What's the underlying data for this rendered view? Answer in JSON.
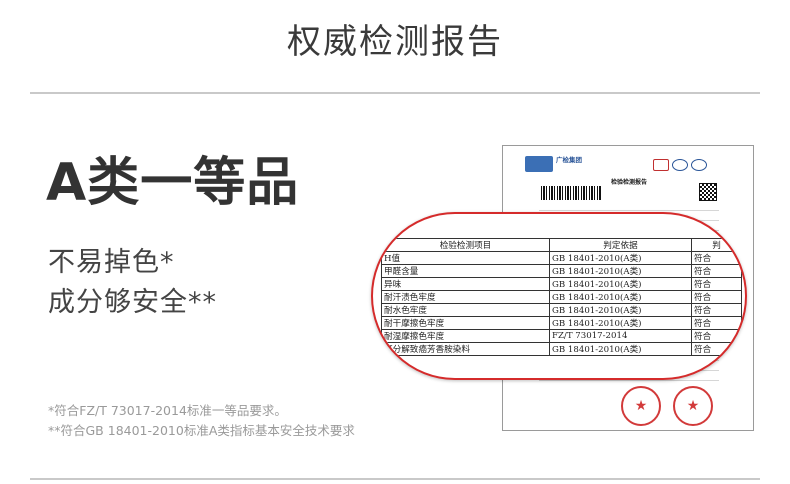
{
  "page": {
    "title": "权威检测报告",
    "headline": "A类一等品",
    "subtitle_1": "不易掉色*",
    "subtitle_2": "成分够安全**",
    "note_1": "*符合FZ/T 73017-2014标准一等品要求。",
    "note_2": "**符合GB 18401-2010标准A类指标基本安全技术要求"
  },
  "report": {
    "brand": "广检集团",
    "heading": "检验检测报告",
    "stamp_symbol": "★"
  },
  "table": {
    "headers": [
      "检验检测项目",
      "判定依据",
      "判"
    ],
    "rows": [
      {
        "item": "H值",
        "basis": "GB 18401-2010(A类)",
        "result": "符合"
      },
      {
        "item": "甲醛含量",
        "basis": "GB 18401-2010(A类)",
        "result": "符合"
      },
      {
        "item": "异味",
        "basis": "GB 18401-2010(A类)",
        "result": "符合"
      },
      {
        "item": "耐汗渍色牢度",
        "basis": "GB 18401-2010(A类)",
        "result": "符合"
      },
      {
        "item": "耐水色牢度",
        "basis": "GB 18401-2010(A类)",
        "result": "符合"
      },
      {
        "item": "耐干摩擦色牢度",
        "basis": "GB 18401-2010(A类)",
        "result": "符合"
      },
      {
        "item": "耐湿摩擦色牢度",
        "basis": "FZ/T 73017-2014",
        "result": "符合"
      },
      {
        "item": "可分解致癌芳香胺染料",
        "basis": "GB 18401-2010(A类)",
        "result": "符合"
      }
    ]
  }
}
